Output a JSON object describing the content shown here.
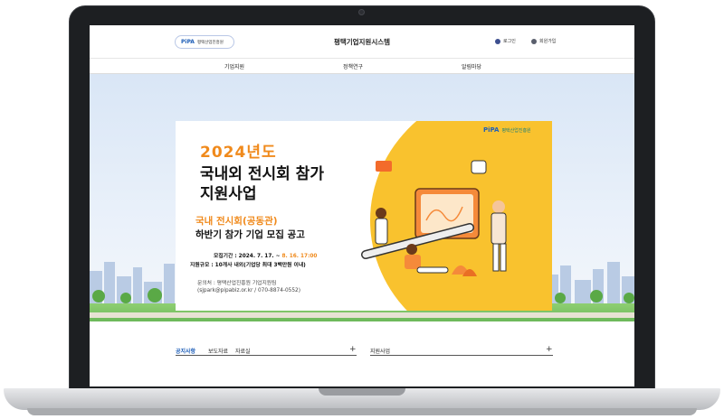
{
  "header": {
    "logo_mark": "PiPA",
    "logo_text": "평택산업진흥원",
    "site_title": "평택기업지원시스템",
    "login_label": "로그인",
    "signup_label": "회원가입"
  },
  "nav": {
    "items": [
      {
        "label": "기업지원"
      },
      {
        "label": "정책연구"
      },
      {
        "label": "알림마당"
      }
    ]
  },
  "banner": {
    "year_title": "2024년도",
    "title_line1": "국내외 전시회 참가",
    "title_line2": "지원사업",
    "sub_line1": "국내 전시회(공동관)",
    "sub_line2": "하반기 참가 기업 모집 공고",
    "period_label": "모집기간 : 2024. 7. 17. ~ ",
    "period_end": "8. 16. 17:00",
    "scale": "지원규모 : 10개사 내외(기업당 최대 3백만원 이내)",
    "contact1": "문의처 : 평택산업진흥원 기업지원팀",
    "contact2": "(sjpark@pipabiz.or.kr / 070-8874-0552)",
    "logo_mark": "PiPA",
    "logo_text": "평택산업진흥원"
  },
  "board": {
    "tabs": [
      {
        "label": "공지사항"
      },
      {
        "label": "보도자료"
      },
      {
        "label": "자료실"
      }
    ],
    "tab_plus": "+",
    "second_title": "지원사업",
    "second_plus": "+"
  },
  "colors": {
    "accent_blue": "#1f5fb8",
    "poster_yellow": "#f9c22e",
    "poster_orange": "#f08a1c"
  }
}
